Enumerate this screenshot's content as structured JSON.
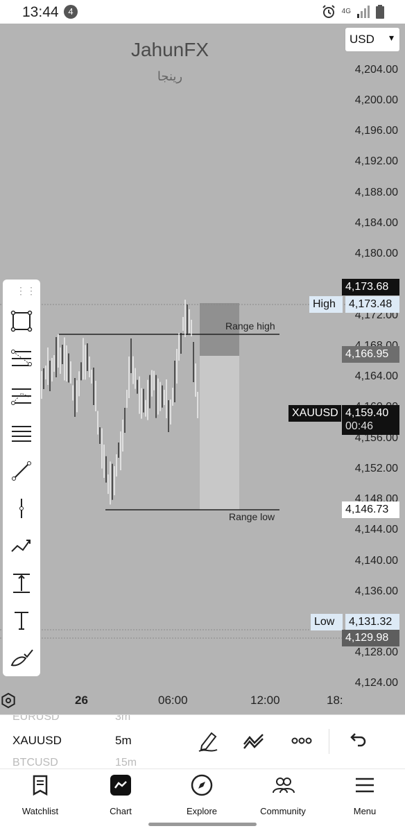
{
  "status_bar": {
    "time": "13:44",
    "notification_count": "4",
    "network": "4G"
  },
  "chart": {
    "watermark": {
      "title": "JahunFX",
      "subtitle": "رینجا"
    },
    "currency": {
      "selected": "USD"
    },
    "price_axis": [
      "4,204.00",
      "4,200.00",
      "4,196.00",
      "4,192.00",
      "4,188.00",
      "4,184.00",
      "4,180.00",
      "4,172.00",
      "4,168.00",
      "4,164.00",
      "4,160.00",
      "4,156.00",
      "4,152.00",
      "4,148.00",
      "4,144.00",
      "4,140.00",
      "4,136.00",
      "4,128.00",
      "4,124.00"
    ],
    "badges": {
      "top_price": "4,173.68",
      "high_label": "High",
      "high_value": "4,173.48",
      "mid_price": "4,166.95",
      "symbol": "XAUUSD",
      "last_price": "4,159.40",
      "countdown": "00:46",
      "range_low_price": "4,146.73",
      "low_label": "Low",
      "low_value": "4,131.32",
      "bottom_price": "4,129.98"
    },
    "annotations": {
      "range_high": "Range high",
      "range_low": "Range low"
    },
    "time_axis": {
      "day": "26",
      "t1": "06:00",
      "t2": "12:00",
      "t3": "18:"
    },
    "colors": {
      "background": "#b4b4b4",
      "candle": "#ffffff",
      "candle_down": "#222222",
      "range_box": "#8c8c8c",
      "range_box_light": "#c8c8c8"
    }
  },
  "symbol_picker": {
    "items": [
      {
        "symbol": "EURUSD",
        "interval": "3m"
      },
      {
        "symbol": "XAUUSD",
        "interval": "5m"
      },
      {
        "symbol": "BTCUSD",
        "interval": "15m"
      }
    ]
  },
  "actions": [
    "pencil-icon",
    "drawing-tools-icon",
    "more-icon",
    "undo-icon"
  ],
  "nav": {
    "watchlist": "Watchlist",
    "chart": "Chart",
    "explore": "Explore",
    "community": "Community",
    "menu": "Menu"
  }
}
